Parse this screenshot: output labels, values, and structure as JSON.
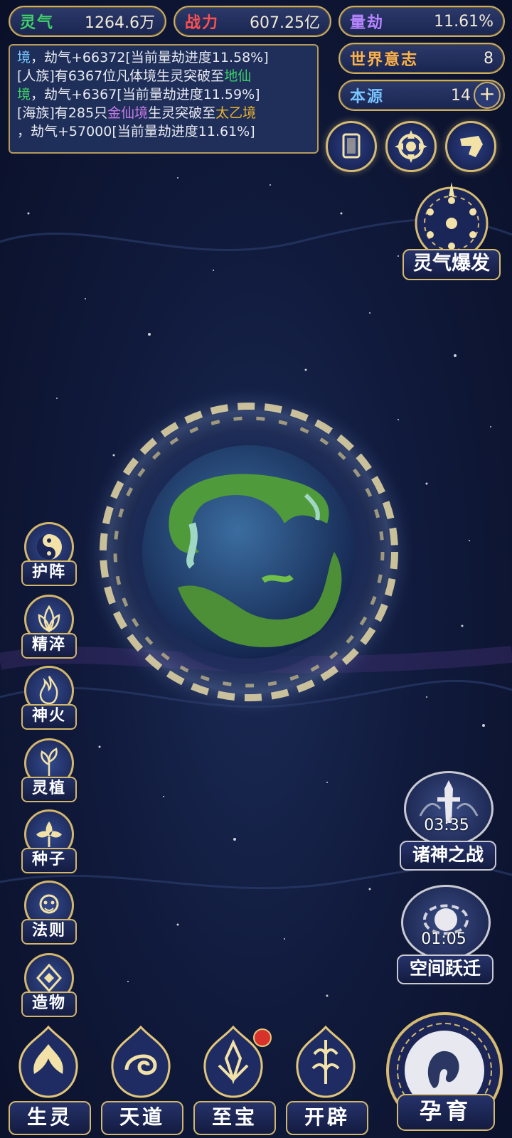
{
  "stats": {
    "lingqi": {
      "label": "灵气",
      "value": "1264.6万",
      "color": "#3fd06a"
    },
    "zhanli": {
      "label": "战力",
      "value": "607.25亿",
      "color": "#ff5050"
    },
    "liangjie": {
      "label": "量劫",
      "value": "11.61%",
      "color": "#b784ff"
    },
    "shijie": {
      "label": "世界意志",
      "value": "8",
      "color": "#ffb347"
    },
    "benyuan": {
      "label": "本源",
      "value": "14",
      "color": "#78c4ff"
    }
  },
  "log": {
    "line0_pre": "境",
    "line0_rest": "，劫气+66372[当前量劫进度11.58%]",
    "line1_a": "[人族]有6367位凡体境生灵突破至",
    "line1_b": "地仙",
    "line1_c": "境",
    "line1_d": "，劫气+6367[当前量劫进度11.59%]",
    "line2_a": "[海族]有285只",
    "line2_b": "金仙境",
    "line2_c": "生灵突破至",
    "line2_d": "太乙境",
    "line2_e": "，劫气+57000[当前量劫进度11.61%]"
  },
  "top_icons": [
    "card-icon",
    "vortex-icon",
    "scroll-icon"
  ],
  "burst": {
    "label": "灵气爆发"
  },
  "side_menu": [
    {
      "label": "护阵",
      "icon": "yin-yang-icon"
    },
    {
      "label": "精淬",
      "icon": "lotus-icon"
    },
    {
      "label": "神火",
      "icon": "flame-icon"
    },
    {
      "label": "灵植",
      "icon": "plant-icon"
    },
    {
      "label": "种子",
      "icon": "seed-icon"
    },
    {
      "label": "法则",
      "icon": "rune-icon"
    },
    {
      "label": "造物",
      "icon": "creation-icon"
    }
  ],
  "events": [
    {
      "label": "诸神之战",
      "time": "03:35",
      "icon": "sword-icon"
    },
    {
      "label": "空间跃迁",
      "time": "01:05",
      "icon": "portal-icon"
    }
  ],
  "bottom_nav": [
    {
      "label": "生灵",
      "icon": "phoenix-icon"
    },
    {
      "label": "天道",
      "icon": "swirl-icon"
    },
    {
      "label": "至宝",
      "icon": "treasure-icon",
      "badge": true
    },
    {
      "label": "开辟",
      "icon": "axe-icon"
    }
  ],
  "yunyu": {
    "label": "孕育"
  }
}
